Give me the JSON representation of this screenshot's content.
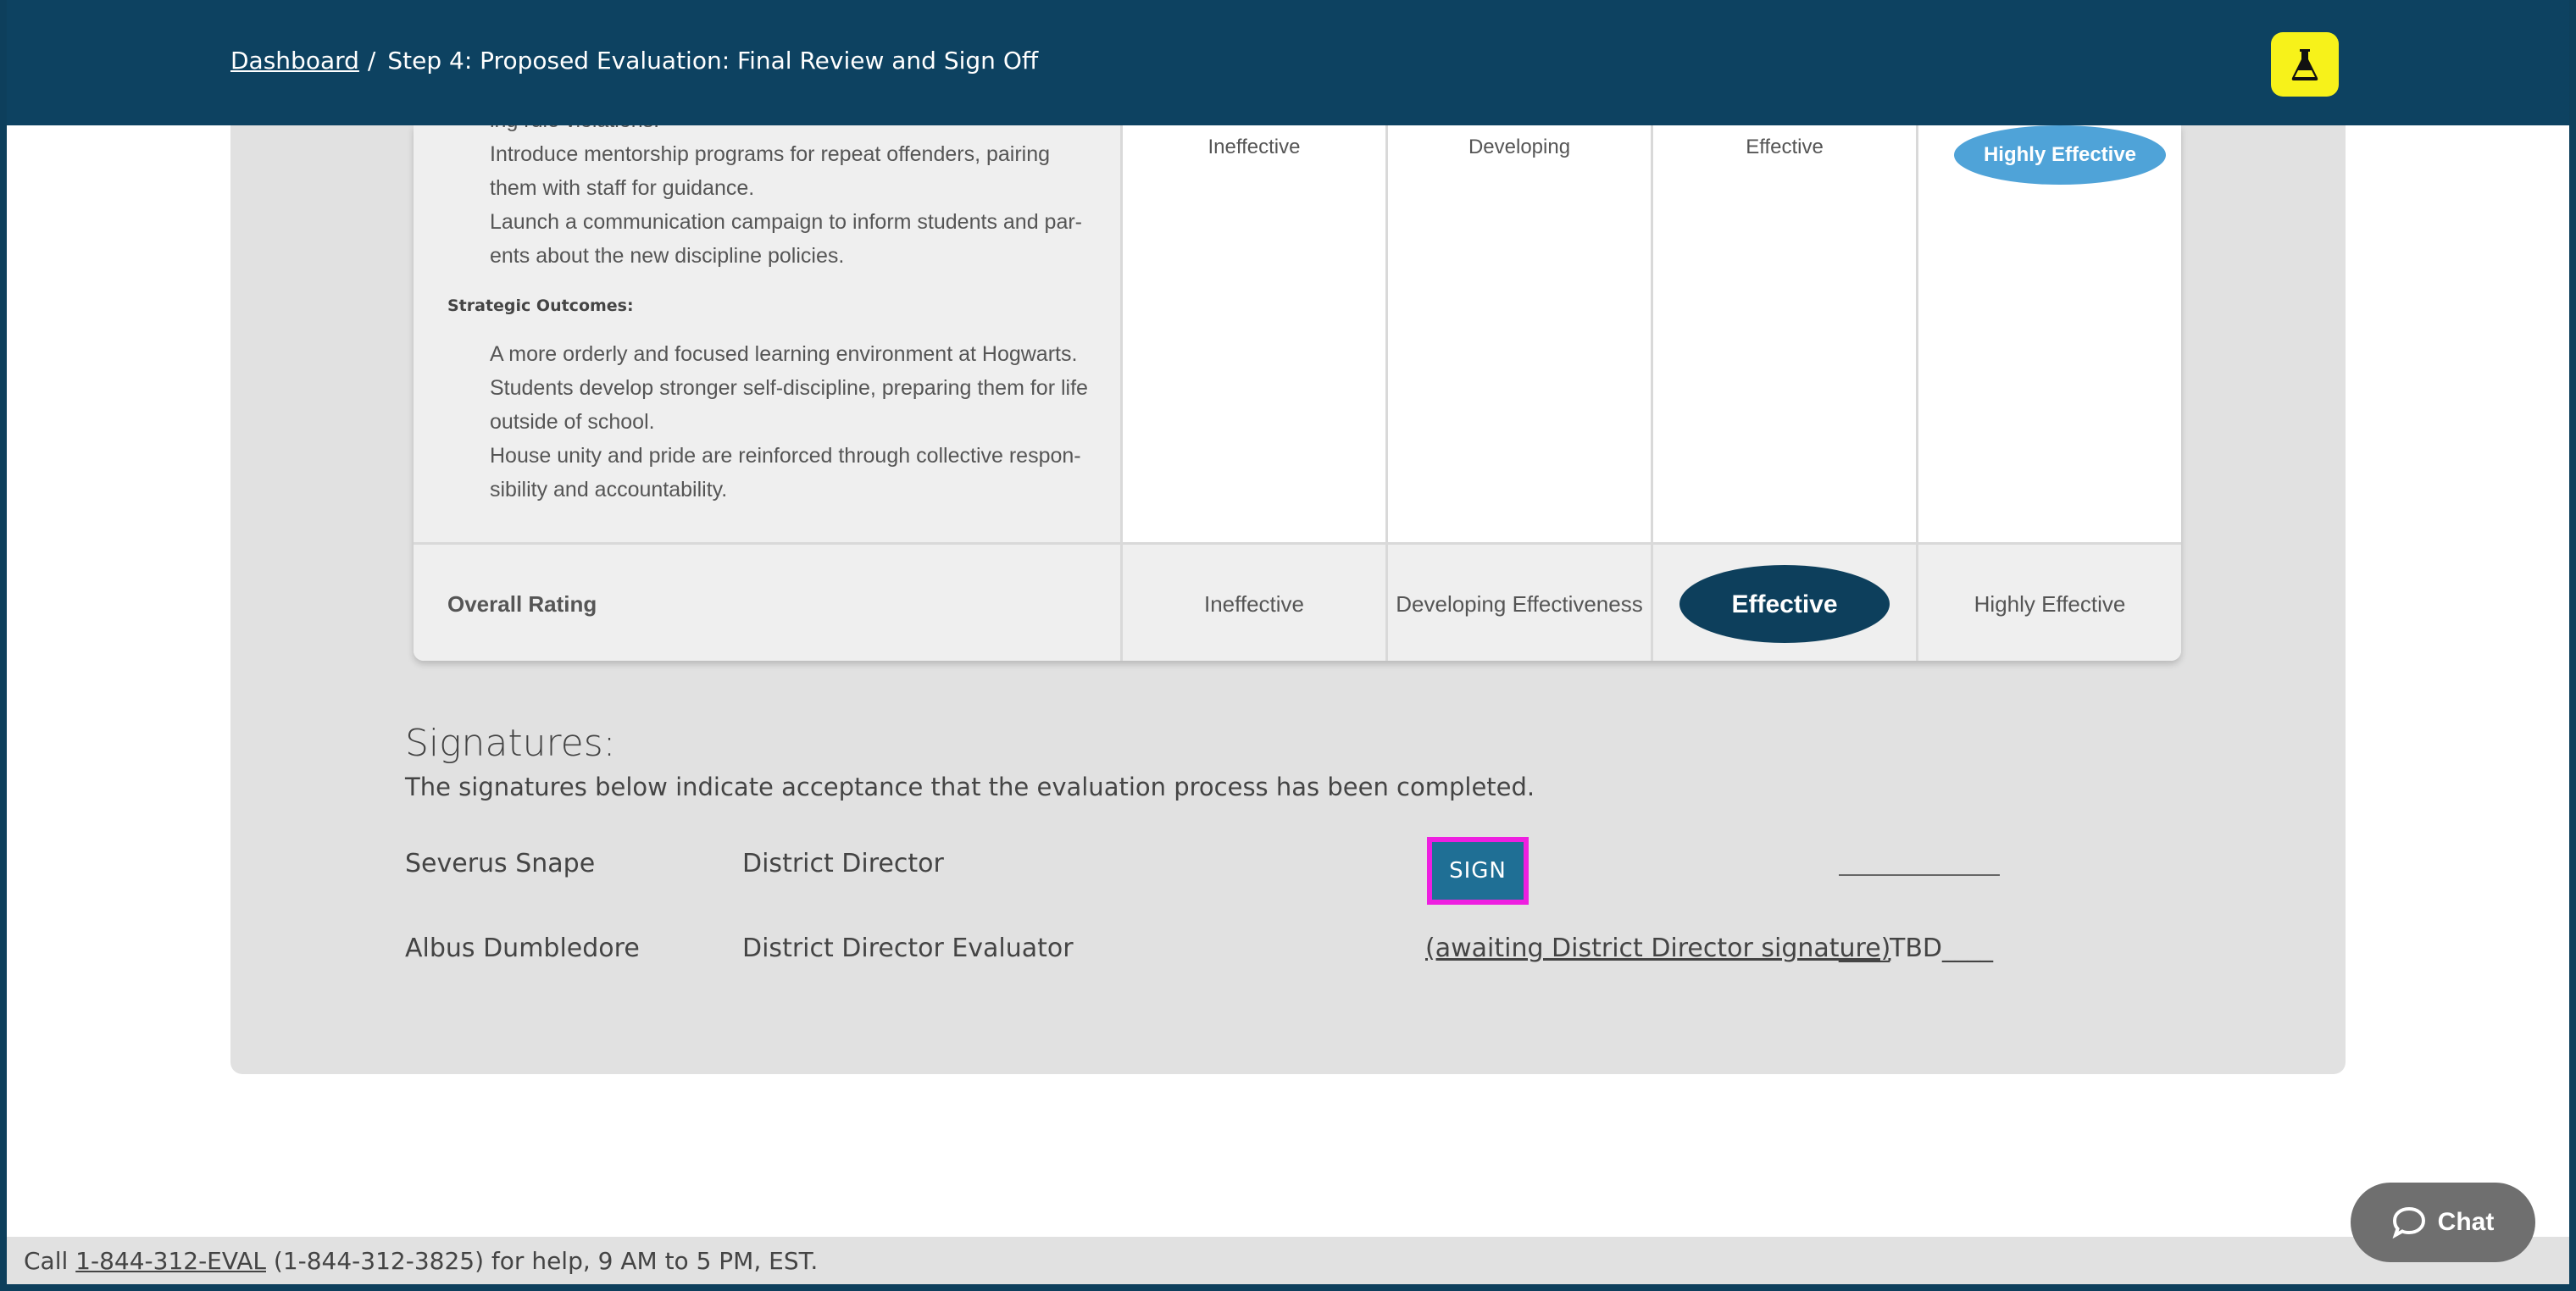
{
  "header": {
    "breadcrumb_link": "Dashboard",
    "breadcrumb_sep": "/",
    "breadcrumb_current": "Step 4: Proposed Evaluation: Final Review and Sign Off",
    "lab_icon": "flask-icon",
    "lab_color": "#f7f21a",
    "brand_color": "#0d4261"
  },
  "goal": {
    "partial_line": "ing rule violations.",
    "actions": [
      "Introduce mentorship programs for repeat offenders, pairing",
      "them with staff for guidance.",
      "Launch a communication campaign to inform students and par-",
      "ents about the new discipline policies."
    ],
    "outcomes_heading": "Strategic Outcomes:",
    "outcomes": [
      "A more orderly and focused learning environment at Hogwarts.",
      "Students develop stronger self-discipline, preparing them for life",
      "outside of school.",
      "House unity and pride are reinforced through collective respon-",
      "sibility and accountability."
    ],
    "ratings": [
      "Ineffective",
      "Developing",
      "Effective",
      "Highly Effective"
    ],
    "selected_rating": "Highly Effective"
  },
  "overall": {
    "label": "Overall Rating",
    "options": [
      "Ineffective",
      "Developing Effectiveness",
      "Effective",
      "Highly Effective"
    ],
    "selected": "Effective"
  },
  "signatures": {
    "title": "Signatures:",
    "subtitle": "The signatures below indicate acceptance that the evaluation process has been completed.",
    "rows": [
      {
        "name": "Severus Snape",
        "role": "District Director",
        "action": "SIGN",
        "date": ""
      },
      {
        "name": "Albus Dumbledore",
        "role": "District Director Evaluator",
        "action": "(awaiting District Director signature)",
        "date": "____TBD____"
      }
    ]
  },
  "footer": {
    "prefix": "Call ",
    "phone_link": "1-844-312-EVAL",
    "suffix": " (1-844-312-3825) for help, 9 AM to 5 PM, EST."
  },
  "chat": {
    "label": "Chat",
    "icon": "chat-bubble-icon"
  }
}
